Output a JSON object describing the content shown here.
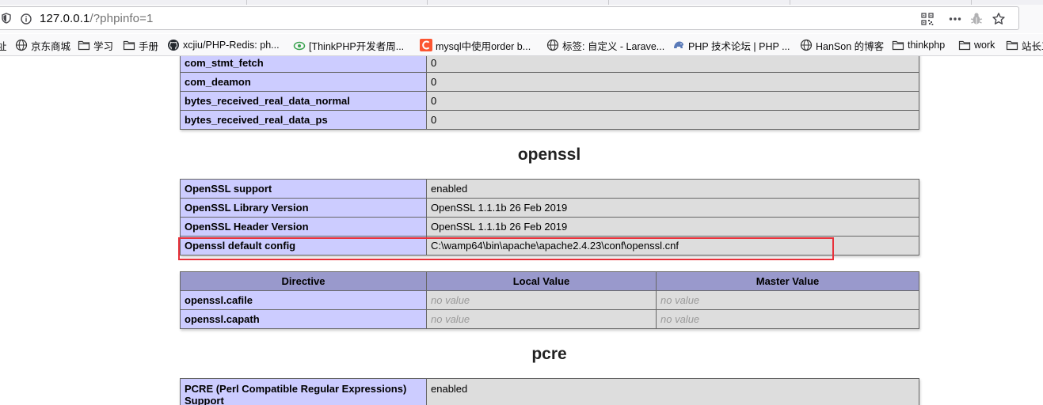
{
  "browser": {
    "url_host": "127.0.0.1",
    "url_path": "/?phpinfo=1",
    "icons": [
      "shield-icon",
      "info-icon",
      "qr-code-icon",
      "more-icon",
      "bug-icon",
      "star-icon"
    ]
  },
  "bookmarks": [
    {
      "label": "址",
      "icon": "none"
    },
    {
      "label": "京东商城",
      "icon": "globe-icon"
    },
    {
      "label": "学习",
      "icon": "folder-icon"
    },
    {
      "label": "手册",
      "icon": "folder-icon"
    },
    {
      "label": "xcjiu/PHP-Redis: ph...",
      "icon": "github-icon"
    },
    {
      "label": "[ThinkPHP开发者周...",
      "icon": "thinkphp-icon"
    },
    {
      "label": "mysql中使用order b...",
      "icon": "csdn-icon"
    },
    {
      "label": "标签: 自定义 - Larave...",
      "icon": "globe-icon"
    },
    {
      "label": "PHP 技术论坛 | PHP ...",
      "icon": "php-icon"
    },
    {
      "label": "HanSon 的博客",
      "icon": "globe-icon"
    },
    {
      "label": "thinkphp",
      "icon": "folder-icon"
    },
    {
      "label": "work",
      "icon": "folder-icon"
    },
    {
      "label": "站长工",
      "icon": "folder-icon"
    }
  ],
  "mysqlnd_tail": [
    {
      "name": "com_stmt_fetch",
      "value": "0"
    },
    {
      "name": "com_deamon",
      "value": "0"
    },
    {
      "name": "bytes_received_real_data_normal",
      "value": "0"
    },
    {
      "name": "bytes_received_real_data_ps",
      "value": "0"
    }
  ],
  "openssl": {
    "heading": "openssl",
    "rows": [
      {
        "name": "OpenSSL support",
        "value": "enabled"
      },
      {
        "name": "OpenSSL Library Version",
        "value": "OpenSSL 1.1.1b 26 Feb 2019"
      },
      {
        "name": "OpenSSL Header Version",
        "value": "OpenSSL 1.1.1b 26 Feb 2019"
      },
      {
        "name": "Openssl default config",
        "value": "C:\\wamp64\\bin\\apache\\apache2.4.23\\conf\\openssl.cnf"
      }
    ],
    "directive_headers": [
      "Directive",
      "Local Value",
      "Master Value"
    ],
    "directives": [
      {
        "name": "openssl.cafile",
        "local": "no value",
        "master": "no value"
      },
      {
        "name": "openssl.capath",
        "local": "no value",
        "master": "no value"
      }
    ]
  },
  "pcre": {
    "heading": "pcre",
    "rows": [
      {
        "name": "PCRE (Perl Compatible Regular Expressions) Support",
        "value": "enabled"
      }
    ]
  },
  "colors": {
    "entry_bg": "#ccccff",
    "value_bg": "#dddddd",
    "header_bg": "#9999cc",
    "highlight": "#e8313a"
  }
}
